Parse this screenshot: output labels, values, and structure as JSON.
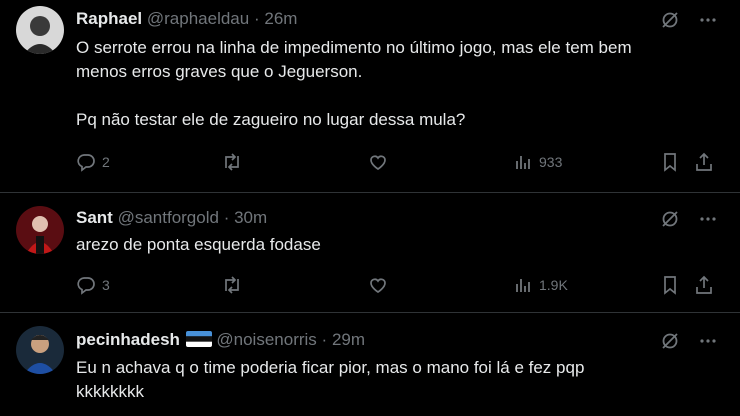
{
  "tweets": [
    {
      "name": "Raphael",
      "handle": "@raphaeldau",
      "time": "26m",
      "text": "O serrote errou na linha de impedimento no último jogo, mas ele tem bem\nmenos erros graves que o Jeguerson.\n\nPq não testar ele de zagueiro no lugar dessa mula?",
      "replies": "2",
      "reposts": "",
      "likes": "",
      "views": "933",
      "avatar_color": "#c9c9c9"
    },
    {
      "name": "Sant",
      "handle": "@santforgold",
      "time": "30m",
      "text": "arezo de ponta esquerda fodase",
      "replies": "3",
      "reposts": "",
      "likes": "",
      "views": "1.9K",
      "avatar_color": "#8b1a1a"
    },
    {
      "name": "pecinhadesh",
      "handle": "@noisenorris",
      "time": "29m",
      "text": "Eu n achava q o time poderia ficar pior, mas o mano foi lá e fez pqp\nkkkkkkkk",
      "avatar_color": "#1e4fa3",
      "flag": "estonia-flag"
    }
  ],
  "separator": "·",
  "icons": [
    "grok-icon",
    "more-icon",
    "reply-icon",
    "repost-icon",
    "like-icon",
    "views-icon",
    "bookmark-icon",
    "share-icon"
  ],
  "colors": {
    "text": "#e7e9ea",
    "muted": "#71767b",
    "divider": "#2f3336",
    "background": "#000000"
  }
}
